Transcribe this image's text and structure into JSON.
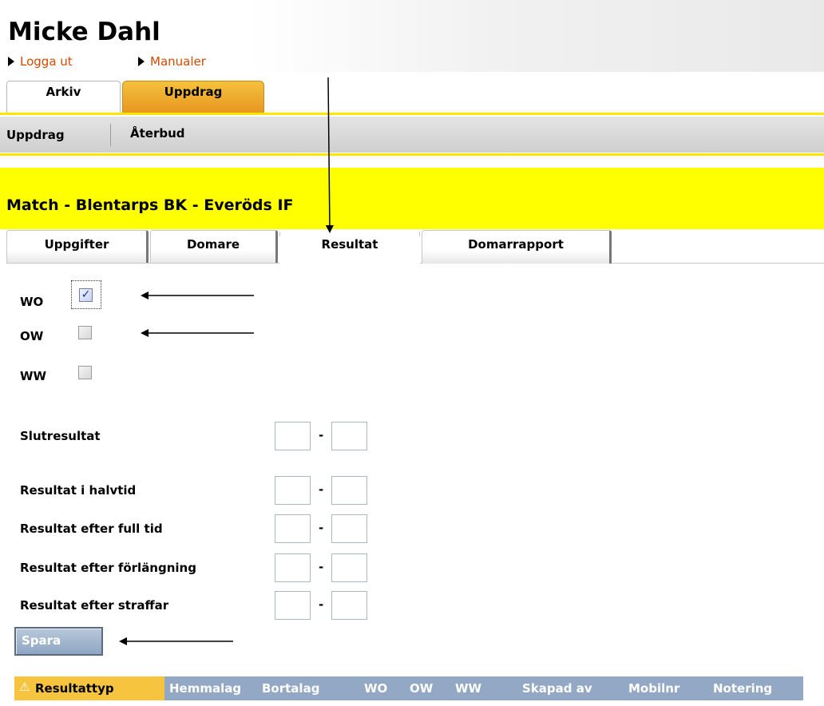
{
  "user": {
    "name": "Micke Dahl"
  },
  "toplinks": {
    "logout": "Logga ut",
    "manuals": "Manualer"
  },
  "main_tabs": [
    {
      "label": "Arkiv"
    },
    {
      "label": "Uppdrag"
    }
  ],
  "subnav": [
    {
      "label": "Uppdrag"
    },
    {
      "label": "Återbud"
    }
  ],
  "match": {
    "title": "Match - Blentarps BK - Everöds IF"
  },
  "detail_tabs": [
    {
      "label": "Uppgifter"
    },
    {
      "label": "Domare"
    },
    {
      "label": "Resultat"
    },
    {
      "label": "Domarrapport"
    }
  ],
  "form": {
    "wo": {
      "label": "WO",
      "checked": true
    },
    "ow": {
      "label": "OW",
      "checked": false
    },
    "ww": {
      "label": "WW",
      "checked": false
    },
    "dash": "-",
    "rows": [
      {
        "label": "Slutresultat",
        "home": "",
        "away": ""
      },
      {
        "label": "Resultat i halvtid",
        "home": "",
        "away": ""
      },
      {
        "label": "Resultat efter full tid",
        "home": "",
        "away": ""
      },
      {
        "label": "Resultat efter förlängning",
        "home": "",
        "away": ""
      },
      {
        "label": "Resultat efter straffar",
        "home": "",
        "away": ""
      }
    ],
    "save_label": "Spara"
  },
  "table": {
    "columns": [
      "Resultattyp",
      "Hemmalag",
      "Bortalag",
      "WO",
      "OW",
      "WW",
      "Skapad av",
      "Mobilnr",
      "Notering"
    ]
  },
  "colors": {
    "accent_yellow": "#ffff00",
    "tab_orange": "#f0a830",
    "link_orange": "#d24a00",
    "table_header": "#92a8c4"
  },
  "icons": {
    "link_bullet": "triangle-right-icon",
    "sort": "warning-icon"
  }
}
